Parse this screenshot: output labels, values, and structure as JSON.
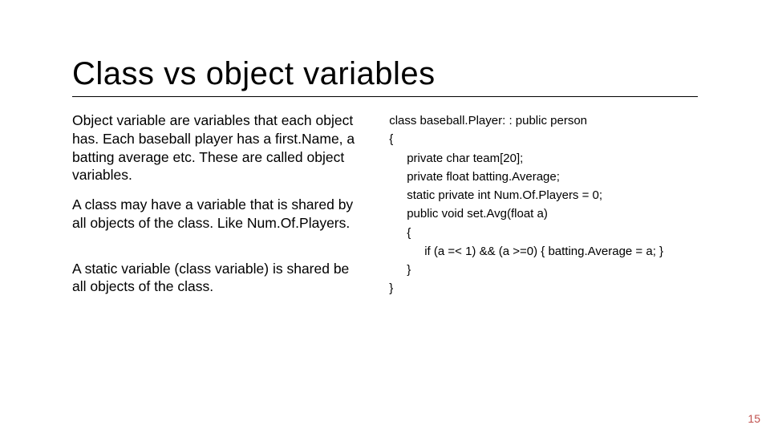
{
  "title": "Class vs object variables",
  "left": {
    "p1": "Object variable are variables that each object has.  Each baseball player has a first.Name, a batting average etc. These are called object variables.",
    "p2": "A class may have a variable that is shared by all objects of the class. Like Num.Of.Players.",
    "p3": "A static variable (class variable) is shared be all objects of the class."
  },
  "code": {
    "l1": "class baseball.Player: : public person",
    "l2": "{",
    "l3": "private char team[20];",
    "l4": "private float batting.Average;",
    "l5": "static private int Num.Of.Players = 0;",
    "l6": "public void set.Avg(float a)",
    "l7": "{",
    "l8": "if (a =< 1) && (a >=0) { batting.Average = a; }",
    "l9": "}",
    "l10": "}"
  },
  "page_number": "15"
}
